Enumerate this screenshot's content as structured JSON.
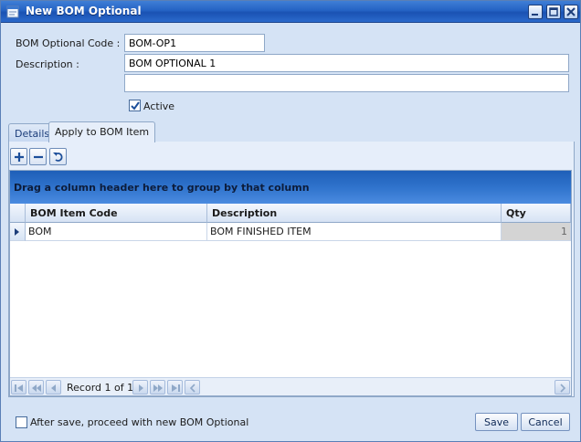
{
  "window": {
    "title": "New BOM Optional",
    "controls": [
      "minimize",
      "maximize",
      "close"
    ]
  },
  "form": {
    "code_label": "BOM Optional Code :",
    "code_value": "BOM-OP1",
    "description_label": "Description :",
    "description_value": "BOM OPTIONAL 1",
    "description2_value": "",
    "active_label": "Active",
    "active_checked": true
  },
  "tabs": [
    {
      "label": "Details",
      "active": false
    },
    {
      "label": "Apply to BOM Item",
      "active": true
    }
  ],
  "toolbar": {
    "add_icon": "plus-icon",
    "remove_icon": "minus-icon",
    "undo_icon": "undo-icon"
  },
  "grid": {
    "group_panel_text": "Drag a column header here to group by that column",
    "columns": [
      "BOM Item Code",
      "Description",
      "Qty"
    ],
    "rows": [
      {
        "code": "BOM",
        "description": "BOM FINISHED ITEM",
        "qty": "1"
      }
    ],
    "navigator_text": "Record 1 of 1"
  },
  "footer": {
    "proceed_label": "After save, proceed with new BOM Optional",
    "proceed_checked": false,
    "save_label": "Save",
    "cancel_label": "Cancel"
  },
  "colors": {
    "titlebar": "#2563c4",
    "window_bg": "#d5e3f5",
    "group_panel": "#2f73cc"
  }
}
